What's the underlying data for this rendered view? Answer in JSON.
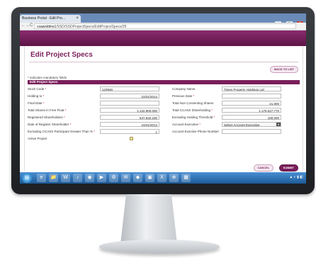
{
  "browser": {
    "tab_title": "Business Portal - Edit Pro...",
    "tab_close": "×",
    "url_host": "csawsldms1",
    "url_path": "/SSD/SSDProjectSpecs/EditProjectSpecs/25",
    "back": "←",
    "forward": "→",
    "reload": "C"
  },
  "page": {
    "title": "Edit Project Specs",
    "back_to_list": "BACK TO LIST",
    "mandatory_note": "* indicates mandatory fields",
    "section_title": "Edit Project Specs",
    "cancel": "CANCEL",
    "submit": "SUBMIT"
  },
  "form": {
    "stock_code": {
      "label": "Stock Code",
      "value": "123946"
    },
    "company_name": {
      "label": "Company Name",
      "value": "Times Property Holdings Ltd"
    },
    "holding_to": {
      "label": "Holding to",
      "value": "10/31/2014"
    },
    "previous_date": {
      "label": "Previous Date",
      "value": ""
    },
    "final_date": {
      "label": "Final Date",
      "value": ""
    },
    "total_non_consenting": {
      "label": "Total Non Consenting Shares",
      "value": "21,000"
    },
    "total_shares_in_free_float": {
      "label": "Total Shares in Free Float",
      "value": "1,132,900,000"
    },
    "total_ccass_shareholding": {
      "label": "Total CCASS Shareholding",
      "value": "1,176,027,770"
    },
    "registered_shareholders": {
      "label": "Registered Shareholders",
      "value": "547,632,230"
    },
    "excluding_holding_threshold": {
      "label": "Excluding Holding Threshold",
      "value": "100,000"
    },
    "date_of_register_shareholder": {
      "label": "Date of Register Shareholder",
      "value": "10/31/2014"
    },
    "account_executive": {
      "label": "Account Executive",
      "value": "Select Account Executive"
    },
    "excluding_ccass_participant": {
      "label": "Excluding CCASS Participant Greater Than %",
      "value": "1"
    },
    "account_exec_phone": {
      "label": "Account Exective Phone Number",
      "value": ""
    },
    "active_project": {
      "label": "Active Project",
      "checked": true
    }
  },
  "taskbar": {
    "start": "⊞",
    "icons": [
      "e",
      "📁",
      "W",
      "♪",
      "◉",
      "▶",
      "⚙",
      "✉",
      "◆",
      "▣",
      "X",
      "⊕",
      "▦"
    ],
    "tray": "▲ ◐ ▮ ◧"
  }
}
